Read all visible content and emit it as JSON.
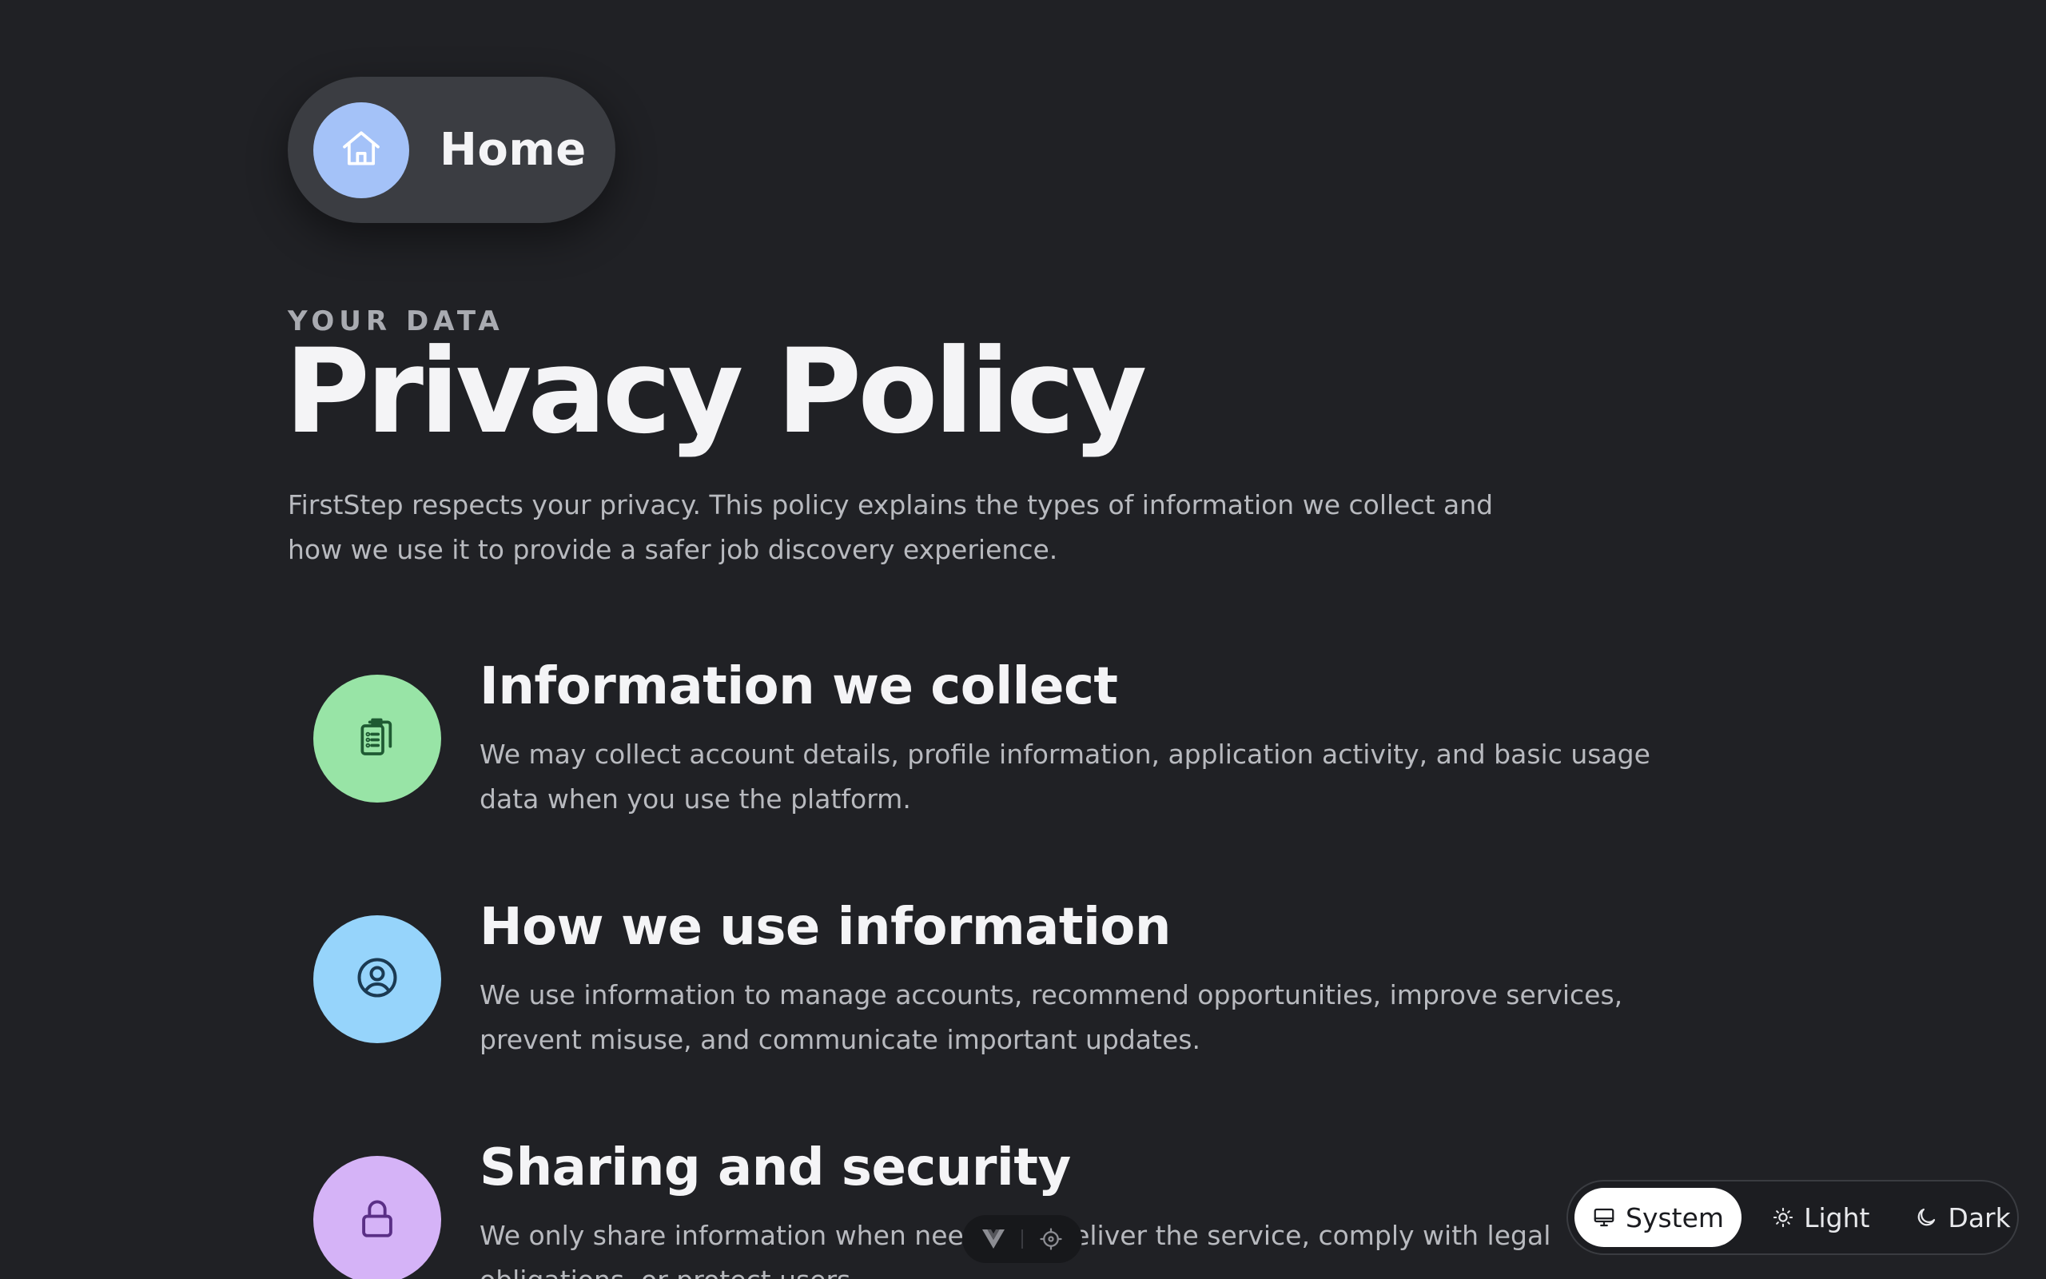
{
  "nav": {
    "home_label": "Home",
    "home_icon": "home-icon",
    "home_icon_bg": "#a4c2f8"
  },
  "header": {
    "eyebrow": "YOUR DATA",
    "title": "Privacy Policy",
    "intro": "FirstStep respects your privacy. This policy explains the types of information we collect and how we use it to provide a safer job discovery experience."
  },
  "sections": [
    {
      "title": "Information we collect",
      "body": "We may collect account details, profile information, application activity, and basic usage data when you use the platform.",
      "icon": "clipboard-icon",
      "icon_bg": "#98e4a6"
    },
    {
      "title": "How we use information",
      "body": "We use information to manage accounts, recommend opportunities, improve services, prevent misuse, and communicate important updates.",
      "icon": "user-circle-icon",
      "icon_bg": "#96d4fb"
    },
    {
      "title": "Sharing and security",
      "body": "We only share information when needed to deliver the service, comply with legal obligations, or protect users.",
      "icon": "lock-icon",
      "icon_bg": "#d5b3f7"
    }
  ],
  "devtools": {
    "vue_icon": "vue-logo-icon",
    "inspect_icon": "crosshair-icon"
  },
  "theme_switcher": {
    "options": [
      {
        "label": "System",
        "icon": "monitor-icon",
        "active": true
      },
      {
        "label": "Light",
        "icon": "sun-icon",
        "active": false
      },
      {
        "label": "Dark",
        "icon": "moon-icon",
        "active": false
      }
    ]
  }
}
